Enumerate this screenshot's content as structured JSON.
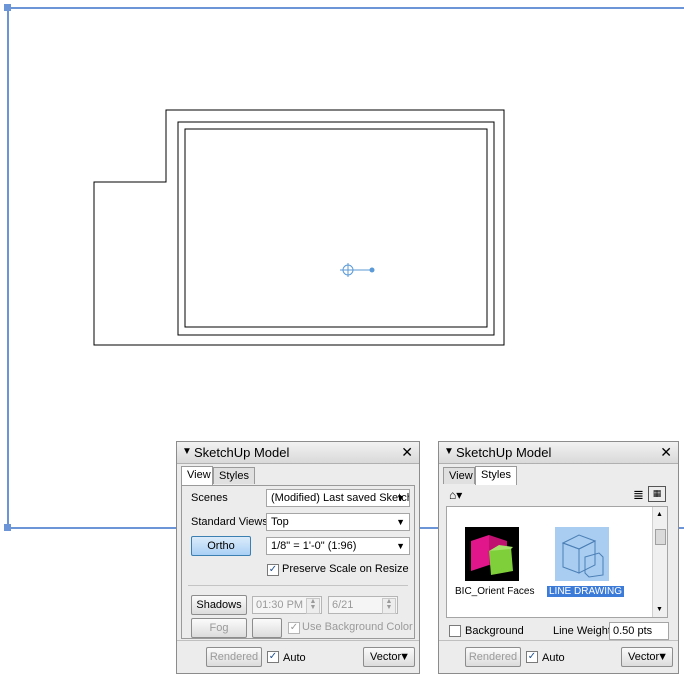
{
  "colors": {
    "viewport_border": "#6b95d6",
    "axis_marker": "#5b9ad6",
    "selected_label_bg": "#3d7bd9",
    "magenta_face": "#e0168a",
    "green_face": "#7fcf3a"
  },
  "left_panel": {
    "title": "SketchUp Model",
    "tabs": [
      "View",
      "Styles"
    ],
    "active_tab": "View",
    "scenes_label": "Scenes",
    "scenes_value": "(Modified) Last saved SketchU",
    "standard_views_label": "Standard Views",
    "standard_views_value": "Top",
    "ortho_button": "Ortho",
    "scale_value": "1/8\" = 1'-0\" (1:96)",
    "preserve_scale_label": "Preserve Scale on Resize",
    "preserve_scale_checked": true,
    "shadows_button": "Shadows",
    "time_value": "01:30 PM",
    "date_value": "6/21",
    "fog_button": "Fog",
    "use_bg_color_label": "Use Background Color",
    "footer_rendered": "Rendered",
    "footer_auto": "Auto",
    "footer_vector": "Vector",
    "close_icon": "✕"
  },
  "right_panel": {
    "title": "SketchUp Model",
    "tabs": [
      "View",
      "Styles"
    ],
    "active_tab": "Styles",
    "style1_label": "BIC_Orient Faces",
    "style2_label": "LINE DRAWING",
    "background_label": "Background",
    "line_weight_label": "Line Weight",
    "line_weight_value": "0.50 pts",
    "footer_rendered": "Rendered",
    "footer_auto": "Auto",
    "footer_vector": "Vector",
    "close_icon": "✕"
  }
}
